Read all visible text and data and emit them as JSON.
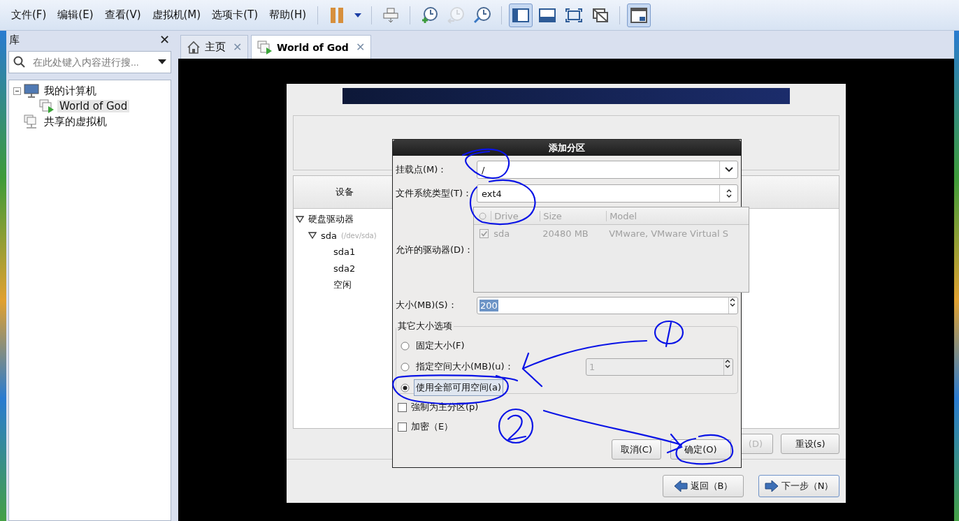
{
  "menu": [
    "文件(F)",
    "编辑(E)",
    "查看(V)",
    "虚拟机(M)",
    "选项卡(T)",
    "帮助(H)"
  ],
  "toolbar_groups": [
    [
      {
        "kind": "pause",
        "selected": false,
        "disabled": false
      },
      {
        "kind": "dropdown",
        "selected": false,
        "disabled": false
      }
    ],
    [
      {
        "kind": "send-keys",
        "selected": false,
        "disabled": false
      }
    ],
    [
      {
        "kind": "snapshot",
        "selected": false,
        "disabled": false
      },
      {
        "kind": "revert",
        "selected": false,
        "disabled": true
      },
      {
        "kind": "manager",
        "selected": false,
        "disabled": false
      }
    ],
    [
      {
        "kind": "console",
        "selected": true,
        "disabled": false
      },
      {
        "kind": "bottom",
        "selected": false,
        "disabled": false
      },
      {
        "kind": "fullscreen",
        "selected": false,
        "disabled": false
      },
      {
        "kind": "unity",
        "selected": false,
        "disabled": false
      }
    ],
    [
      {
        "kind": "thumbnail",
        "selected": true,
        "disabled": false
      }
    ]
  ],
  "library": {
    "title": "库",
    "close": "✕",
    "search": {
      "placeholder": "在此处键入内容进行搜..."
    },
    "tree": [
      {
        "label": "我的计算机",
        "kind": "computer",
        "selected": false,
        "expanded": true,
        "children": [
          {
            "label": "World of God",
            "kind": "vm",
            "selected": true
          }
        ]
      },
      {
        "label": "共享的虚拟机",
        "kind": "shared",
        "selected": false
      }
    ]
  },
  "tabs": [
    {
      "label": "主页",
      "kind": "home",
      "selected": false,
      "close": "✕"
    },
    {
      "label": "World of God",
      "kind": "vm",
      "selected": true,
      "close": "✕"
    }
  ],
  "installer": {
    "devices": {
      "header": "设备",
      "tree": [
        {
          "label": "硬盘驱动器",
          "expanded": true,
          "children": [
            {
              "label": "sda",
              "detail": "(/dev/sda)",
              "expanded": true,
              "children": [
                {
                  "label": "sda1"
                },
                {
                  "label": "sda2"
                },
                {
                  "label": "空闲"
                }
              ]
            }
          ]
        }
      ]
    },
    "buttons": [
      {
        "label": "(D)",
        "disabled": true
      },
      {
        "label": "重设(s)",
        "disabled": false
      }
    ],
    "nav": [
      {
        "label": "返回（B）",
        "kind": "back"
      },
      {
        "label": "下一步（N）",
        "kind": "next"
      }
    ]
  },
  "dialog": {
    "title": "添加分区",
    "mount_point": {
      "label": "挂载点(M)：",
      "value": "/"
    },
    "fs_type": {
      "label": "文件系统类型(T)：",
      "value": "ext4"
    },
    "drives": {
      "label": "允许的驱动器(D)：",
      "disabled": true,
      "columns": [
        "Drive",
        "Size",
        "Model"
      ],
      "rows": [
        {
          "checked": true,
          "drive": "sda",
          "size": "20480 MB",
          "model": "VMware, VMware Virtual S"
        }
      ]
    },
    "size": {
      "label": "大小(MB)(S)：",
      "value": "200"
    },
    "size_options": {
      "title": "其它大小选项",
      "options": [
        {
          "label": "固定大小(F)",
          "selected": false
        },
        {
          "label": "指定空间大小(MB)(u)：",
          "selected": false,
          "value": "1"
        },
        {
          "label": "使用全部可用空间(a)",
          "selected": true
        }
      ]
    },
    "checks": [
      {
        "label": "強制为主分区(p)",
        "checked": false
      },
      {
        "label": "加密（E）",
        "checked": false
      }
    ],
    "buttons": [
      {
        "label": "取消(C)",
        "kind": "cancel"
      },
      {
        "label": "确定(O)",
        "kind": "ok"
      }
    ]
  }
}
